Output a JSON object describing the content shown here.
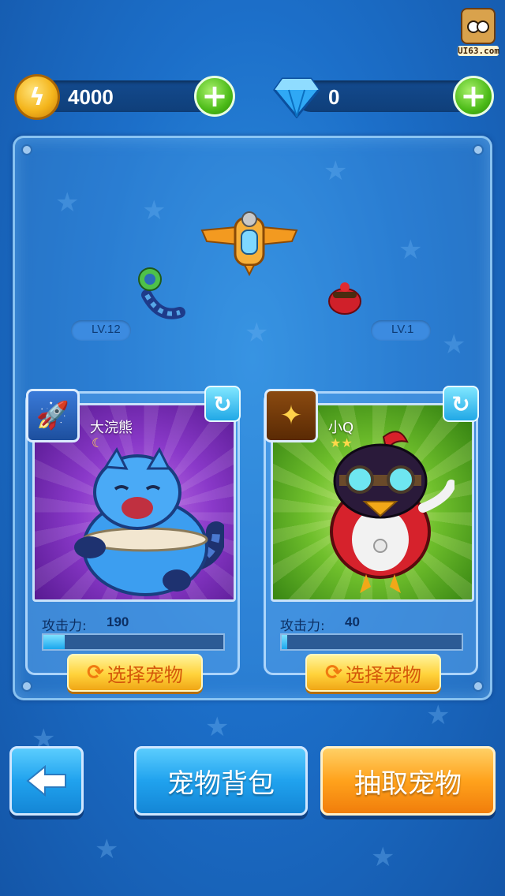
{
  "watermark": {
    "text": "UI63.com"
  },
  "currency": {
    "coins": {
      "icon": "gold-coin-icon",
      "value": "4000",
      "add_icon": "plus-icon"
    },
    "gems": {
      "icon": "diamond-icon",
      "value": "0",
      "add_icon": "plus-icon"
    }
  },
  "scene": {
    "left_pet_level": "LV.12",
    "right_pet_level": "LV.1"
  },
  "pets": [
    {
      "name": "大浣熊",
      "skill_icon": "rocket-skill-icon",
      "badge_icon": "moon-icon",
      "attack_label": "攻击力:",
      "attack_value": "190",
      "attack_progress": 0.12,
      "select_label": "选择宠物",
      "portrait_color": "#8a39c9"
    },
    {
      "name": "小Q",
      "skill_icon": "golden-wings-icon",
      "badge_icon": "star-icon",
      "stars": 2,
      "attack_label": "攻击力:",
      "attack_value": "40",
      "attack_progress": 0.03,
      "select_label": "选择宠物",
      "portrait_color": "#6fbf2c"
    }
  ],
  "bottom": {
    "back_icon": "arrow-left-icon",
    "bag_label": "宠物背包",
    "draw_label": "抽取宠物"
  }
}
